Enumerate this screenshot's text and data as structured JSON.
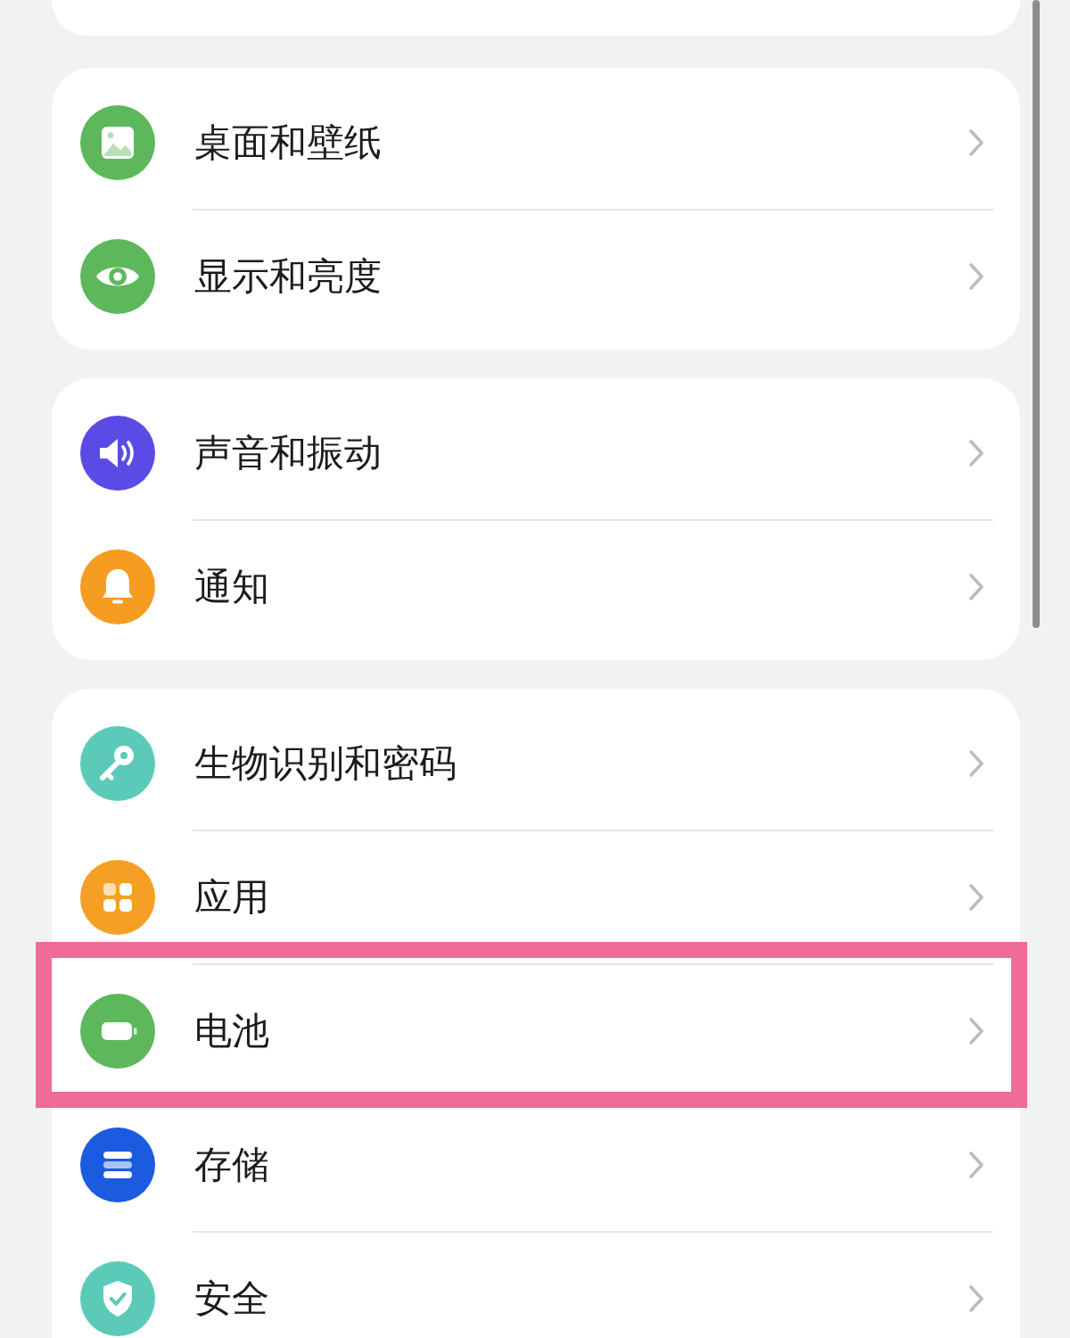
{
  "card_above_visible": true,
  "groups": [
    {
      "items": [
        {
          "label": "桌面和壁纸",
          "kind": "image",
          "color": "#5db85b",
          "highlighted": false
        },
        {
          "label": "显示和亮度",
          "kind": "eye",
          "color": "#5db85b",
          "highlighted": false
        }
      ]
    },
    {
      "items": [
        {
          "label": "声音和振动",
          "kind": "speaker",
          "color": "#5a4be6",
          "highlighted": false
        },
        {
          "label": "通知",
          "kind": "bell",
          "color": "#f59c21",
          "highlighted": false
        }
      ]
    },
    {
      "items": [
        {
          "label": "生物识别和密码",
          "kind": "key",
          "color": "#5ccab8",
          "highlighted": false
        },
        {
          "label": "应用",
          "kind": "apps",
          "color": "#f5a024",
          "highlighted": false
        },
        {
          "label": "电池",
          "kind": "battery",
          "color": "#5db85b",
          "highlighted": true
        },
        {
          "label": "存储",
          "kind": "storage",
          "color": "#1b5be0",
          "highlighted": false
        },
        {
          "label": "安全",
          "kind": "shield",
          "color": "#5ccab8",
          "highlighted": false
        }
      ]
    }
  ]
}
